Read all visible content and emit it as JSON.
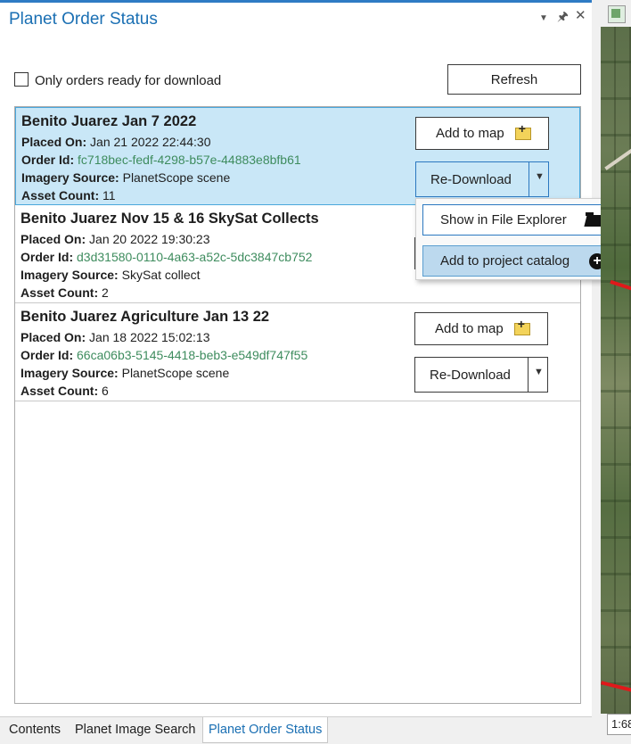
{
  "panel": {
    "title": "Planet Order Status",
    "filter_label": "Only orders ready for download",
    "filter_checked": false,
    "refresh_label": "Refresh"
  },
  "labels": {
    "placed_on": "Placed On:",
    "order_id": "Order Id:",
    "imagery_source": "Imagery Source:",
    "asset_count": "Asset Count:"
  },
  "orders": [
    {
      "title": "Benito Juarez Jan 7 2022",
      "placed_on": "Jan 21 2022 22:44:30",
      "order_id": "fc718bec-fedf-4298-b57e-44883e8bfb61",
      "imagery_source": "PlanetScope scene",
      "asset_count": "11",
      "add_label": "Add to map",
      "redownload_label": "Re-Download",
      "selected": true
    },
    {
      "title": "Benito Juarez Nov 15 & 16 SkySat Collects",
      "placed_on": "Jan 20 2022 19:30:23",
      "order_id": "d3d31580-0110-4a63-a52c-5dc3847cb752",
      "imagery_source": "SkySat collect",
      "asset_count": "2",
      "selected": false
    },
    {
      "title": "Benito Juarez Agriculture Jan 13 22",
      "placed_on": "Jan 18 2022 15:02:13",
      "order_id": "66ca06b3-5145-4418-beb3-e549df747f55",
      "imagery_source": "PlanetScope scene",
      "asset_count": "6",
      "add_label": "Add to map",
      "redownload_label": "Re-Download",
      "selected": false
    }
  ],
  "dropdown_menu": {
    "items": [
      {
        "label": "Show in File Explorer",
        "icon": "open-folder-icon"
      },
      {
        "label": "Add to project catalog",
        "icon": "plus-circle-icon",
        "hovered": true
      }
    ]
  },
  "tabs": [
    {
      "label": "Contents",
      "active": false
    },
    {
      "label": "Planet Image Search",
      "active": false
    },
    {
      "label": "Planet Order Status",
      "active": true
    }
  ],
  "map": {
    "scale_text": "1:68"
  },
  "colors": {
    "accent": "#1a6fb3",
    "selected_row": "#c9e7f7",
    "order_id_text": "#3e8c5e"
  }
}
